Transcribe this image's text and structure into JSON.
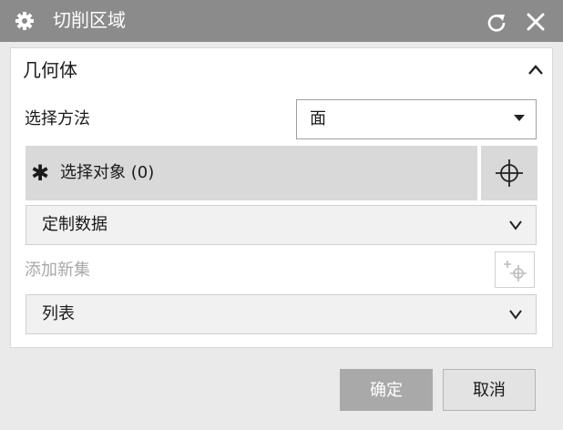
{
  "dialog": {
    "title": "切削区域",
    "title_icon": "gear-icon",
    "reset_icon": "reset-icon",
    "close_icon": "close-icon"
  },
  "geometry": {
    "group_title": "几何体",
    "collapse_icon": "chevron-up-icon",
    "method_label": "选择方法",
    "method_value": "面",
    "select_object_label": "选择对象 (0)",
    "required_icon": "asterisk-icon",
    "target_icon": "crosshair-icon",
    "custom_data_label": "定制数据",
    "add_new_set_label": "添加新集",
    "add_set_icon": "add-set-icon",
    "list_label": "列表"
  },
  "footer": {
    "ok_label": "确定",
    "cancel_label": "取消"
  },
  "colors": {
    "titlebar": "#8b8b8b",
    "selected_row": "#d9d9d9",
    "disabled_button": "#a9a9a9"
  }
}
